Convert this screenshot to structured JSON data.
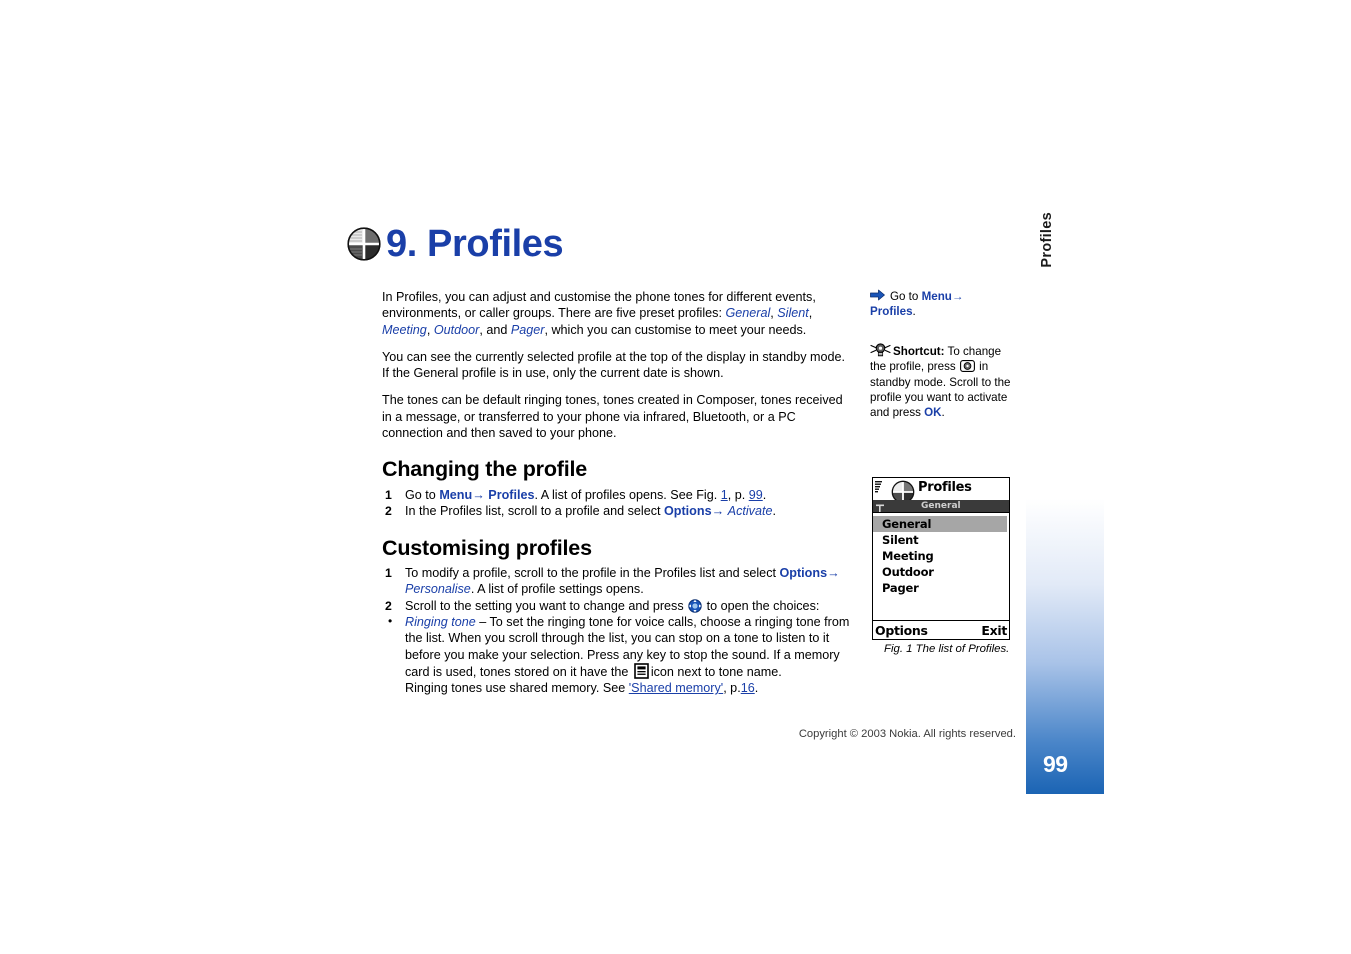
{
  "chapter": {
    "icon": "profiles-sphere-icon",
    "title": "9. Profiles"
  },
  "main": {
    "intro_paragraphs": [
      {
        "id": "p1",
        "text_runs": [
          {
            "t": "In Profiles, you can adjust and customise the phone tones for different events, environments, or caller groups. There are five preset profiles: ",
            "style": "plain"
          },
          {
            "t": "General",
            "style": "blue-italic"
          },
          {
            "t": ", ",
            "style": "plain"
          },
          {
            "t": "Silent",
            "style": "blue-italic"
          },
          {
            "t": ", ",
            "style": "plain"
          },
          {
            "t": "Meeting",
            "style": "blue-italic"
          },
          {
            "t": ", ",
            "style": "plain"
          },
          {
            "t": "Outdoor",
            "style": "blue-italic"
          },
          {
            "t": ", and ",
            "style": "plain"
          },
          {
            "t": "Pager",
            "style": "blue-italic"
          },
          {
            "t": ", which you can customise to meet your needs.",
            "style": "plain"
          }
        ]
      },
      {
        "id": "p2",
        "text": "You can see the currently selected profile at the top of the display in standby mode. If the General profile is in use, only the current date is shown."
      },
      {
        "id": "p3",
        "text": "The tones can be default ringing tones, tones created in Composer, tones received in a message, or transferred to your phone via infrared, Bluetooth, or a PC connection and then saved to your phone."
      }
    ],
    "section1": {
      "heading": "Changing the profile",
      "steps": [
        {
          "num": "1",
          "text": "Go to Menu→ Profiles. A list of profiles opens. See Fig. 1, p. 99."
        },
        {
          "num": "2",
          "text": "In the Profiles list, scroll to a profile and select Options→ Activate."
        }
      ]
    },
    "section2": {
      "heading": "Customising profiles",
      "steps": [
        {
          "num": "1",
          "text": "To modify a profile, scroll to the profile in the Profiles list and select Options→ Personalise. A list of profile settings opens."
        },
        {
          "num": "2",
          "text": "Scroll to the setting you want to change and press ⊙ to open the choices:"
        }
      ],
      "bullet": {
        "term": "Ringing tone",
        "text": "– To set the ringing tone for voice calls, choose a ringing tone from the list. When you scroll through the list, you can stop on a tone to listen to it before you make your selection. Press any key to stop the sound. If a memory card is used, tones stored on it have the  icon next to tone name.",
        "followup_pre": "Ringing tones use shared memory. See ",
        "followup_link": "'Shared memory'",
        "followup_mid": ", p.",
        "followup_page": "16",
        "followup_end": "."
      }
    },
    "inline_labels": {
      "go_to": "Go to",
      "menu": "Menu",
      "arrow": "→",
      "profiles": "Profiles",
      "period": ".",
      "see_fig": "See Fig.",
      "fig_num": "1",
      "p_abbrev": "p.",
      "page_ref": "99",
      "options": "Options",
      "activate": "Activate",
      "personalise": "Personalise",
      "ringing_tone": "Ringing tone"
    }
  },
  "side_note": {
    "goto": {
      "icon": "right-arrow-icon",
      "prefix": "Go to",
      "menu": "Menu",
      "arrow": "→",
      "target": "Profiles",
      "end": "."
    },
    "shortcut": {
      "icon": "lightbulb-tip-icon",
      "label": "Shortcut:",
      "line1": "To change the profile, press",
      "key_icon": "navigation-key-icon",
      "line2": "in standby mode. Scroll to the profile you want to activate and press",
      "ok": "OK",
      "end": "."
    }
  },
  "figure": {
    "phone": {
      "title": "Profiles",
      "status_profile": "General",
      "signal_icon": "signal-strength-icon",
      "antenna_icon": "antenna-icon",
      "header_icon": "profiles-sphere-icon",
      "list": [
        {
          "label": "General",
          "selected": true
        },
        {
          "label": "Silent",
          "selected": false
        },
        {
          "label": "Meeting",
          "selected": false
        },
        {
          "label": "Outdoor",
          "selected": false
        },
        {
          "label": "Pager",
          "selected": false
        }
      ],
      "softkey_left": "Options",
      "softkey_right": "Exit"
    },
    "caption": "Fig. 1 The list of Profiles."
  },
  "footer": {
    "copyright": "Copyright © 2003 Nokia. All rights reserved."
  },
  "side_tab": {
    "label": "Profiles",
    "page_number": "99"
  },
  "colors": {
    "heading_blue": "#1a3fa8",
    "link_blue": "#1a3fa8",
    "tab_blue": "#1b64b4",
    "selected_row_gray": "#a6a6a6",
    "status_band_dark": "#3a3a3a"
  }
}
